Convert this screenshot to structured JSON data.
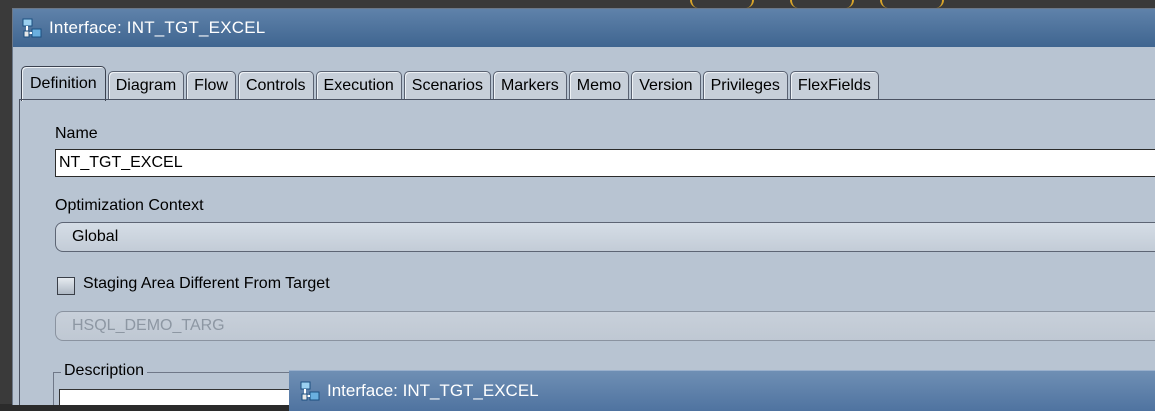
{
  "window": {
    "title": "Interface: INT_TGT_EXCEL"
  },
  "tabs": [
    {
      "label": "Definition",
      "active": true
    },
    {
      "label": "Diagram"
    },
    {
      "label": "Flow"
    },
    {
      "label": "Controls"
    },
    {
      "label": "Execution"
    },
    {
      "label": "Scenarios"
    },
    {
      "label": "Markers"
    },
    {
      "label": "Memo"
    },
    {
      "label": "Version"
    },
    {
      "label": "Privileges"
    },
    {
      "label": "FlexFields"
    }
  ],
  "form": {
    "name_label": "Name",
    "name_value": "NT_TGT_EXCEL",
    "context_label": "Optimization Context",
    "context_value": "Global",
    "staging_label": "Staging Area Different From Target",
    "staging_checked": false,
    "staging_value": "HSQL_DEMO_TARG",
    "description_label": "Description"
  },
  "subwindow": {
    "title": "Interface: INT_TGT_EXCEL"
  },
  "colors": {
    "titlebar": "#4a6f9a",
    "panel": "#b8c4d2",
    "highlight": "#d9a52a"
  },
  "icons": {
    "window_icon": "interface-icon"
  }
}
